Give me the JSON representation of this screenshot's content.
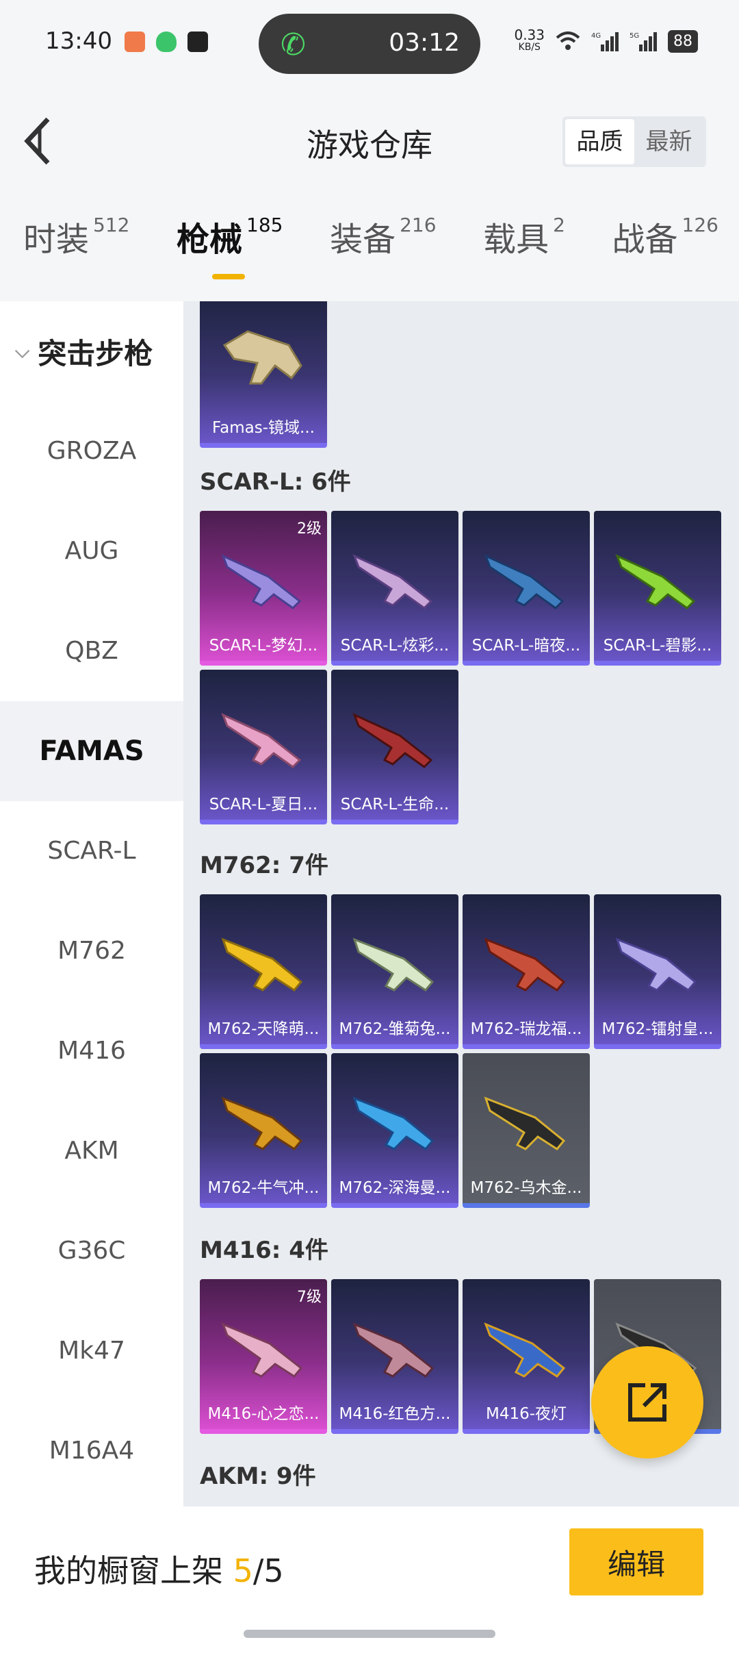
{
  "status": {
    "time": "13:40",
    "call_duration": "03:12",
    "net_speed_value": "0.33",
    "net_speed_unit": "KB/S",
    "battery": "88"
  },
  "header": {
    "title": "游戏仓库",
    "sort_options": [
      "品质",
      "最新"
    ]
  },
  "tabs": [
    {
      "label": "时装",
      "count": "512"
    },
    {
      "label": "枪械",
      "count": "185"
    },
    {
      "label": "装备",
      "count": "216"
    },
    {
      "label": "载具",
      "count": "2"
    },
    {
      "label": "战备",
      "count": "126"
    }
  ],
  "sidebar": {
    "category": "突击步枪",
    "items": [
      "GROZA",
      "AUG",
      "QBZ",
      "FAMAS",
      "SCAR-L",
      "M762",
      "M416",
      "AKM",
      "G36C",
      "Mk47",
      "M16A4"
    ],
    "active": "FAMAS"
  },
  "sections": {
    "famas": {
      "cards": [
        {
          "name": "Famas-镜域...",
          "style": "purple"
        }
      ]
    },
    "scar": {
      "title": "SCAR-L: 6件",
      "cards": [
        {
          "name": "SCAR-L-梦幻...",
          "style": "pink",
          "level": "2级"
        },
        {
          "name": "SCAR-L-炫彩...",
          "style": "purple"
        },
        {
          "name": "SCAR-L-暗夜...",
          "style": "purple"
        },
        {
          "name": "SCAR-L-碧影...",
          "style": "purple"
        },
        {
          "name": "SCAR-L-夏日...",
          "style": "purple"
        },
        {
          "name": "SCAR-L-生命...",
          "style": "purple"
        }
      ]
    },
    "m762": {
      "title": "M762: 7件",
      "cards": [
        {
          "name": "M762-天降萌...",
          "style": "purple"
        },
        {
          "name": "M762-雏菊兔...",
          "style": "purple"
        },
        {
          "name": "M762-瑞龙福...",
          "style": "purple"
        },
        {
          "name": "M762-镭射皇...",
          "style": "purple"
        },
        {
          "name": "M762-牛气冲...",
          "style": "purple"
        },
        {
          "name": "M762-深海曼...",
          "style": "purple"
        },
        {
          "name": "M762-乌木金...",
          "style": "gray"
        }
      ]
    },
    "m416": {
      "title": "M416: 4件",
      "cards": [
        {
          "name": "M416-心之恋...",
          "style": "pink",
          "level": "7级"
        },
        {
          "name": "M416-红色方...",
          "style": "purple"
        },
        {
          "name": "M416-夜灯",
          "style": "purple"
        },
        {
          "name": "",
          "style": "gray"
        }
      ]
    },
    "akm": {
      "title": "AKM: 9件"
    }
  },
  "footer": {
    "showcase_label": "我的橱窗上架",
    "showcase_count": "5",
    "showcase_sep": "/",
    "showcase_total": "5",
    "edit_label": "编辑"
  },
  "colors": {
    "accent": "#fbbd1a",
    "card_purple": "#3a3570",
    "card_pink": "#8a2e8a",
    "card_gray": "#5c6068"
  },
  "icons": {
    "fab": "share-external-icon",
    "back": "back-arrow-icon"
  }
}
